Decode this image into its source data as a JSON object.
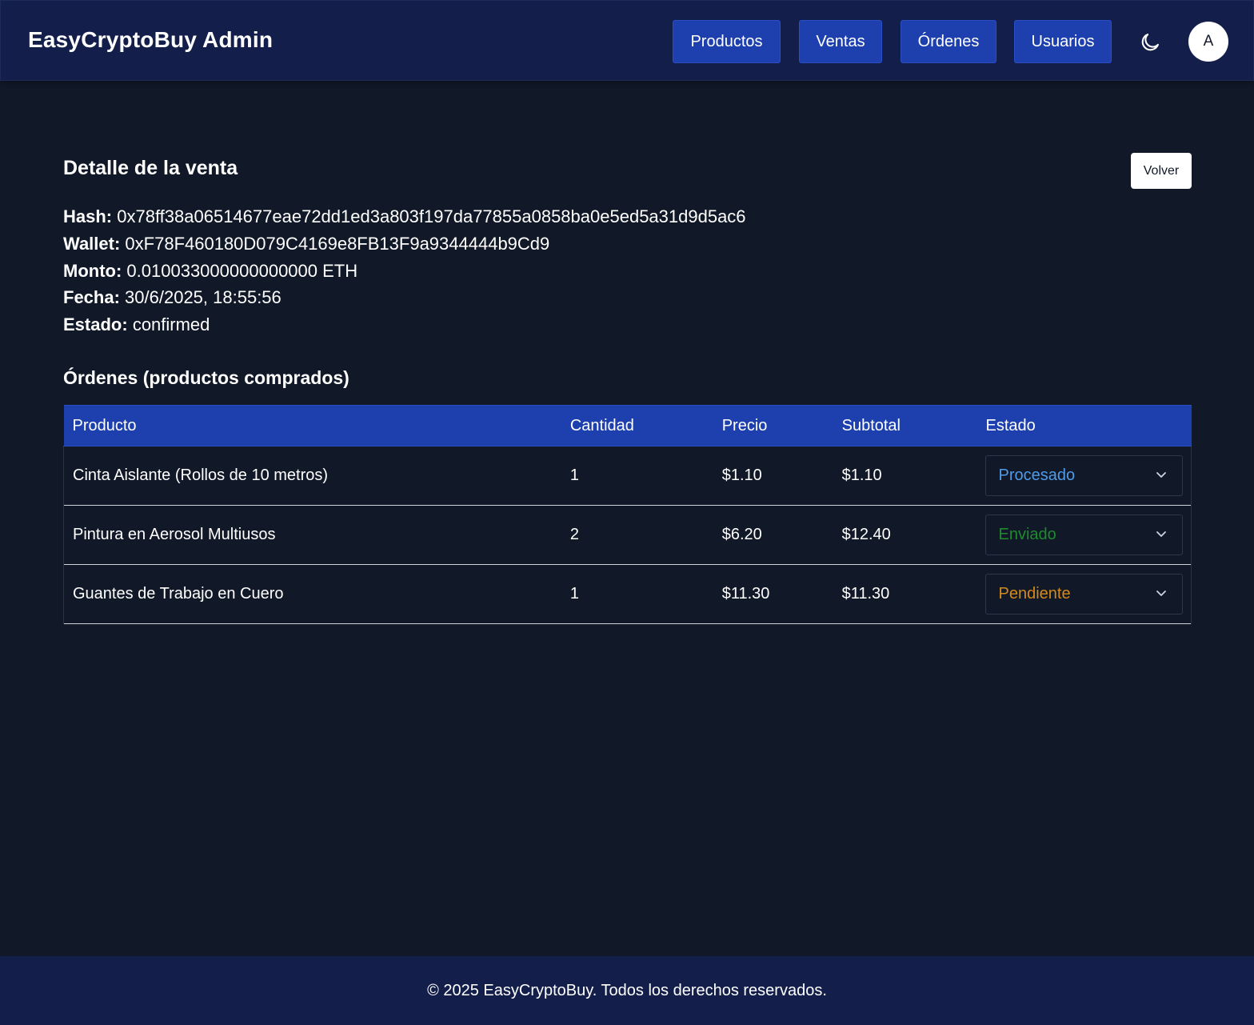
{
  "header": {
    "brand": "EasyCryptoBuy Admin",
    "nav": [
      {
        "label": "Productos"
      },
      {
        "label": "Ventas"
      },
      {
        "label": "Órdenes"
      },
      {
        "label": "Usuarios"
      }
    ],
    "theme_icon": "moon-icon",
    "avatar_initial": "A"
  },
  "sale": {
    "title": "Detalle de la venta",
    "back_label": "Volver",
    "fields": [
      {
        "key": "Hash:",
        "value": "0x78ff38a06514677eae72dd1ed3a803f197da77855a0858ba0e5ed5a31d9d5ac6"
      },
      {
        "key": "Wallet:",
        "value": "0xF78F460180D079C4169e8FB13F9a9344444b9Cd9"
      },
      {
        "key": "Monto:",
        "value": "0.010033000000000000 ETH"
      },
      {
        "key": "Fecha:",
        "value": "30/6/2025, 18:55:56"
      },
      {
        "key": "Estado:",
        "value": "confirmed"
      }
    ]
  },
  "orders": {
    "title": "Órdenes (productos comprados)",
    "columns": [
      "Producto",
      "Cantidad",
      "Precio",
      "Subtotal",
      "Estado"
    ],
    "rows": [
      {
        "product": "Cinta Aislante (Rollos de 10 metros)",
        "qty": "1",
        "price": "$1.10",
        "subtotal": "$1.10",
        "status": "Procesado",
        "status_color": "#4f9be8"
      },
      {
        "product": "Pintura en Aerosol Multiusos",
        "qty": "2",
        "price": "$6.20",
        "subtotal": "$12.40",
        "status": "Enviado",
        "status_color": "#1f8a2e"
      },
      {
        "product": "Guantes de Trabajo en Cuero",
        "qty": "1",
        "price": "$11.30",
        "subtotal": "$11.30",
        "status": "Pendiente",
        "status_color": "#d4891a"
      }
    ]
  },
  "footer": {
    "text": "© 2025 EasyCryptoBuy. Todos los derechos reservados."
  },
  "colors": {
    "background": "#111827",
    "header_bg": "#131f4a",
    "accent": "#1e40af"
  }
}
